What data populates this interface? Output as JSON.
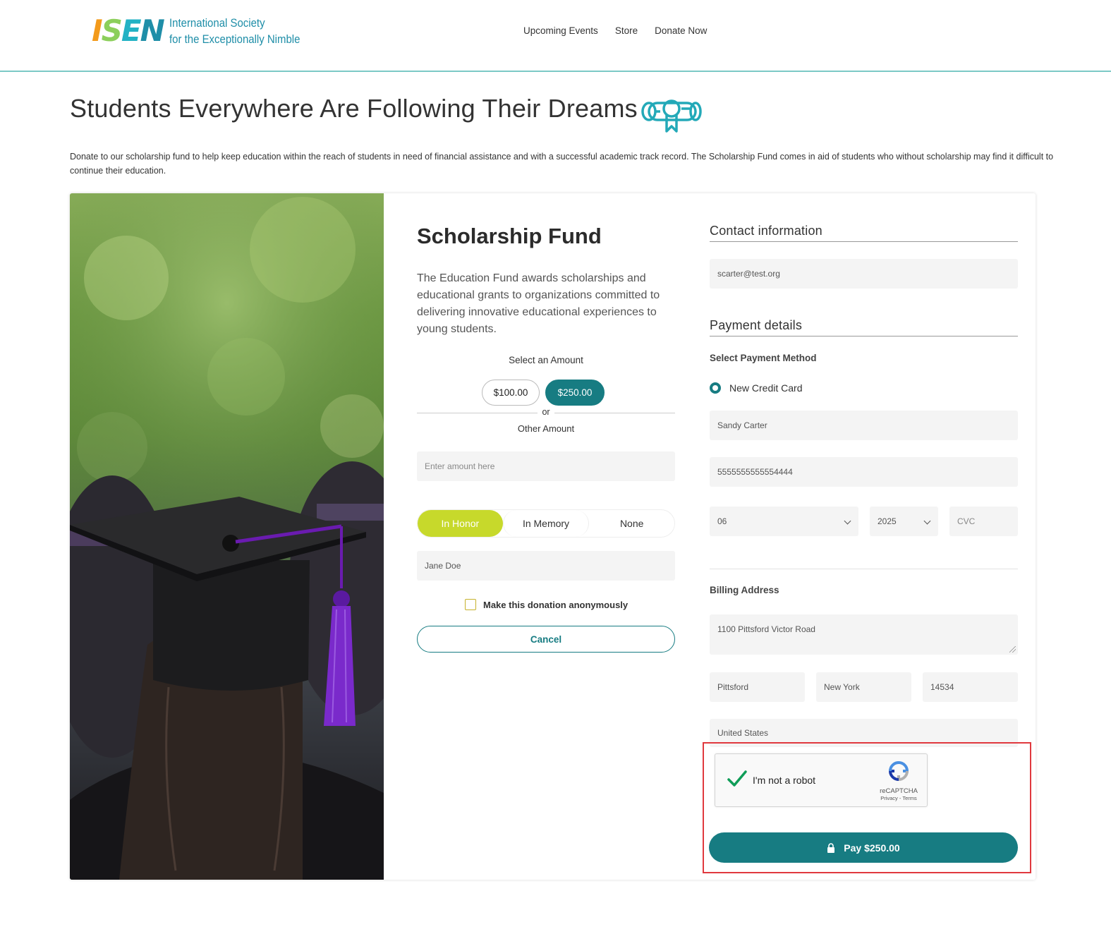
{
  "header": {
    "logo_mark": "ISEN",
    "logo_line1": "International Society",
    "logo_line2": "for the Exceptionally Nimble",
    "nav": [
      "Upcoming Events",
      "Store",
      "Donate Now"
    ]
  },
  "page": {
    "title": "Students Everywhere Are Following Their Dreams",
    "intro": "Donate to our scholarship fund to help keep education within the reach of students in need of financial assistance and with a successful academic track record. The Scholarship Fund comes in aid of students who without scholarship may find it difficult to continue their education."
  },
  "fund": {
    "title": "Scholarship Fund",
    "description": "The Education Fund awards scholarships and educational grants to organizations committed to delivering innovative educational experiences to young students.",
    "select_amount_label": "Select an Amount",
    "amounts": [
      "$100.00",
      "$250.00"
    ],
    "selected_amount": "$250.00",
    "or_label": "or",
    "other_amount_label": "Other Amount",
    "other_amount_placeholder": "Enter amount here",
    "tribute_options": [
      "In Honor",
      "In Memory",
      "None"
    ],
    "tribute_selected": "In Honor",
    "tribute_name": "Jane Doe",
    "anonymous_label": "Make this donation anonymously",
    "anonymous_checked": false,
    "cancel_label": "Cancel"
  },
  "contact": {
    "heading": "Contact information",
    "email": "scarter@test.org"
  },
  "payment": {
    "heading": "Payment details",
    "method_label": "Select Payment Method",
    "method_option": "New Credit Card",
    "cardholder": "Sandy Carter",
    "card_number": "5555555555554444",
    "exp_month": "06",
    "exp_year": "2025",
    "cvc_placeholder": "CVC"
  },
  "billing": {
    "heading": "Billing Address",
    "street": "1100 Pittsford Victor Road",
    "city": "Pittsford",
    "state": "New York",
    "zip": "14534",
    "country": "United States"
  },
  "captcha": {
    "label": "I'm not a robot",
    "brand": "reCAPTCHA",
    "links": "Privacy - Terms",
    "checked": true
  },
  "pay_button": "Pay $250.00",
  "colors": {
    "teal": "#177c82",
    "lime": "#c7d92b",
    "highlight": "#e0393e"
  }
}
